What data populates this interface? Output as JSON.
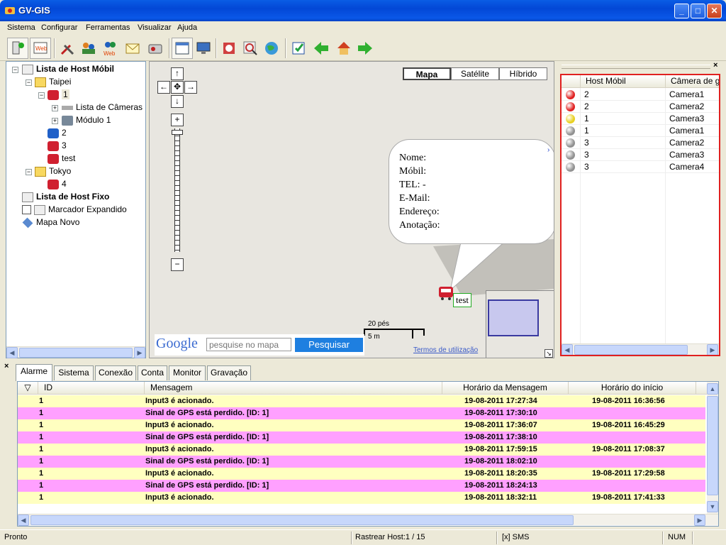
{
  "window": {
    "title": "GV-GIS",
    "min": "_",
    "max": "□",
    "close": "✕"
  },
  "menu": [
    "Sistema",
    "Configurar",
    "Ferramentas",
    "Visualizar",
    "Ajuda"
  ],
  "toolbar": {
    "icons": [
      "host-status-icon",
      "web-icon",
      "tools-icon",
      "users-icon",
      "web-users-icon",
      "mail-icon",
      "video-icon",
      "layout-icon",
      "monitor-icon",
      "export-icon",
      "search-map-icon",
      "globe-icon",
      "edit-icon",
      "back-arrow-icon",
      "home-icon",
      "forward-arrow-icon"
    ]
  },
  "tree": {
    "mobile_list": "Lista de Host Móbil",
    "taipei": "Taipei",
    "host1": "1",
    "cameras": "Lista de Câmeras",
    "module": "Módulo 1",
    "host2": "2",
    "host3": "3",
    "test": "test",
    "tokyo": "Tokyo",
    "host4": "4",
    "fixed_list": "Lista de Host Fixo",
    "marker": "Marcador Expandido",
    "newmap": "Mapa Novo"
  },
  "map": {
    "types": [
      "Mapa",
      "Satélite",
      "Híbrido"
    ],
    "active_type": "Mapa",
    "bubble": [
      "Nome:",
      "Móbil:",
      "TEL: -",
      "E-Mail:",
      "Endereço:",
      "Anotação:"
    ],
    "marker_label": "test",
    "scale_top": "20 pés",
    "scale_bottom": "5 m",
    "terms": "Termos de utilização",
    "google": "Google",
    "search_placeholder": "pesquise no mapa",
    "search_button": "Pesquisar",
    "nav": {
      "up": "↑",
      "down": "↓",
      "left": "←",
      "right": "→",
      "center": "✥",
      "zoom_in": "+",
      "zoom_out": "−"
    }
  },
  "right": {
    "headers": [
      "Host Móbil",
      "Câmera de g"
    ],
    "rows": [
      {
        "status": "#e02020",
        "host": "2",
        "camera": "Camera1"
      },
      {
        "status": "#e02020",
        "host": "2",
        "camera": "Camera2"
      },
      {
        "status": "#e8d020",
        "host": "1",
        "camera": "Camera3"
      },
      {
        "status": "#909090",
        "host": "1",
        "camera": "Camera1"
      },
      {
        "status": "#909090",
        "host": "3",
        "camera": "Camera2"
      },
      {
        "status": "#909090",
        "host": "3",
        "camera": "Camera3"
      },
      {
        "status": "#909090",
        "host": "3",
        "camera": "Camera4"
      }
    ]
  },
  "log": {
    "tabs": [
      "Alarme",
      "Sistema",
      "Conexão",
      "Conta",
      "Monitor",
      "Gravação"
    ],
    "headers": [
      "ID",
      "Mensagem",
      "Horário da Mensagem",
      "Horário do início"
    ],
    "rows": [
      {
        "color": "#ffffc0",
        "id": "1",
        "msg": "Input3 é acionado.",
        "time": "19-08-2011 17:27:34",
        "start": "19-08-2011 16:36:56"
      },
      {
        "color": "#ffa0ff",
        "id": "1",
        "msg": "Sinal de GPS está perdido. [ID: 1]",
        "time": "19-08-2011 17:30:10",
        "start": ""
      },
      {
        "color": "#ffffc0",
        "id": "1",
        "msg": "Input3 é acionado.",
        "time": "19-08-2011 17:36:07",
        "start": "19-08-2011 16:45:29"
      },
      {
        "color": "#ffa0ff",
        "id": "1",
        "msg": "Sinal de GPS está perdido. [ID: 1]",
        "time": "19-08-2011 17:38:10",
        "start": ""
      },
      {
        "color": "#ffffc0",
        "id": "1",
        "msg": "Input3 é acionado.",
        "time": "19-08-2011 17:59:15",
        "start": "19-08-2011 17:08:37"
      },
      {
        "color": "#ffa0ff",
        "id": "1",
        "msg": "Sinal de GPS está perdido. [ID: 1]",
        "time": "19-08-2011 18:02:10",
        "start": ""
      },
      {
        "color": "#ffffc0",
        "id": "1",
        "msg": "Input3 é acionado.",
        "time": "19-08-2011 18:20:35",
        "start": "19-08-2011 17:29:58"
      },
      {
        "color": "#ffa0ff",
        "id": "1",
        "msg": "Sinal de GPS está perdido. [ID: 1]",
        "time": "19-08-2011 18:24:13",
        "start": ""
      },
      {
        "color": "#ffffc0",
        "id": "1",
        "msg": "Input3 é acionado.",
        "time": "19-08-2011 18:32:11",
        "start": "19-08-2011 17:41:33"
      }
    ]
  },
  "status": {
    "left": "Pronto",
    "track": "Rastrear Host:1 / 15",
    "sms": "[x] SMS",
    "num": "NUM"
  }
}
